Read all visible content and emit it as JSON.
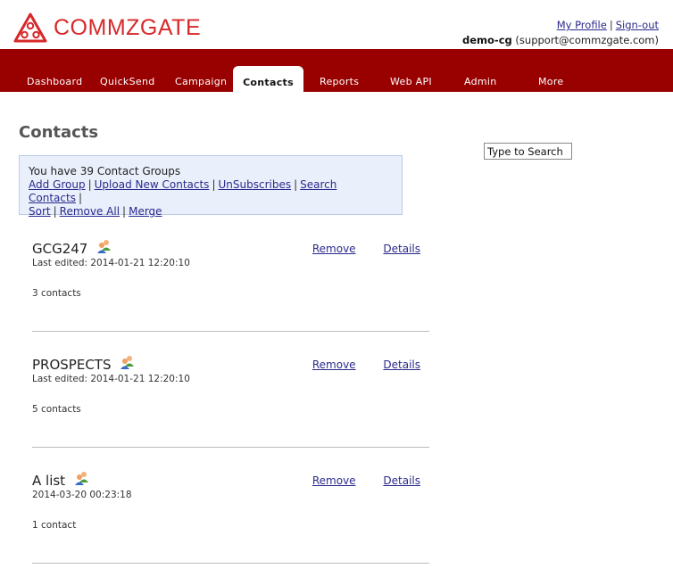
{
  "brand": {
    "name": "COMMZGATE",
    "color": "#d8282a",
    "logo_icon": "commzgate-logo-icon"
  },
  "header": {
    "my_profile": "My Profile",
    "separator": "|",
    "sign_out": "Sign-out",
    "username": "demo-cg",
    "email": "(support@commzgate.com)"
  },
  "nav": {
    "color": "#990000",
    "tabs": [
      {
        "label": "Dashboard"
      },
      {
        "label": "QuickSend"
      },
      {
        "label": "Campaign"
      },
      {
        "label": "Contacts",
        "active": true
      },
      {
        "label": "Reports"
      },
      {
        "label": "Web API"
      },
      {
        "label": "Admin"
      },
      {
        "label": "More"
      }
    ]
  },
  "page": {
    "title": "Contacts"
  },
  "search": {
    "value": "Type to Search"
  },
  "info": {
    "summary": "You have 39 Contact Groups",
    "links": [
      "Add Group",
      "Upload New Contacts",
      "UnSubscribes",
      "Search Contacts",
      "Sort",
      "Remove All",
      "Merge"
    ],
    "separator": "|"
  },
  "groups": [
    {
      "name": "GCG247",
      "edited": "Last edited: 2014-01-21 12:20:10",
      "count": "3 contacts",
      "remove": "Remove",
      "details": "Details",
      "icon": "group-people-icon"
    },
    {
      "name": "PROSPECTS",
      "edited": "Last edited: 2014-01-21 12:20:10",
      "count": "5 contacts",
      "remove": "Remove",
      "details": "Details",
      "icon": "group-people-icon"
    },
    {
      "name": "A list",
      "edited": "2014-03-20 00:23:18",
      "count": "1 contact",
      "remove": "Remove",
      "details": "Details",
      "icon": "group-people-icon"
    }
  ]
}
